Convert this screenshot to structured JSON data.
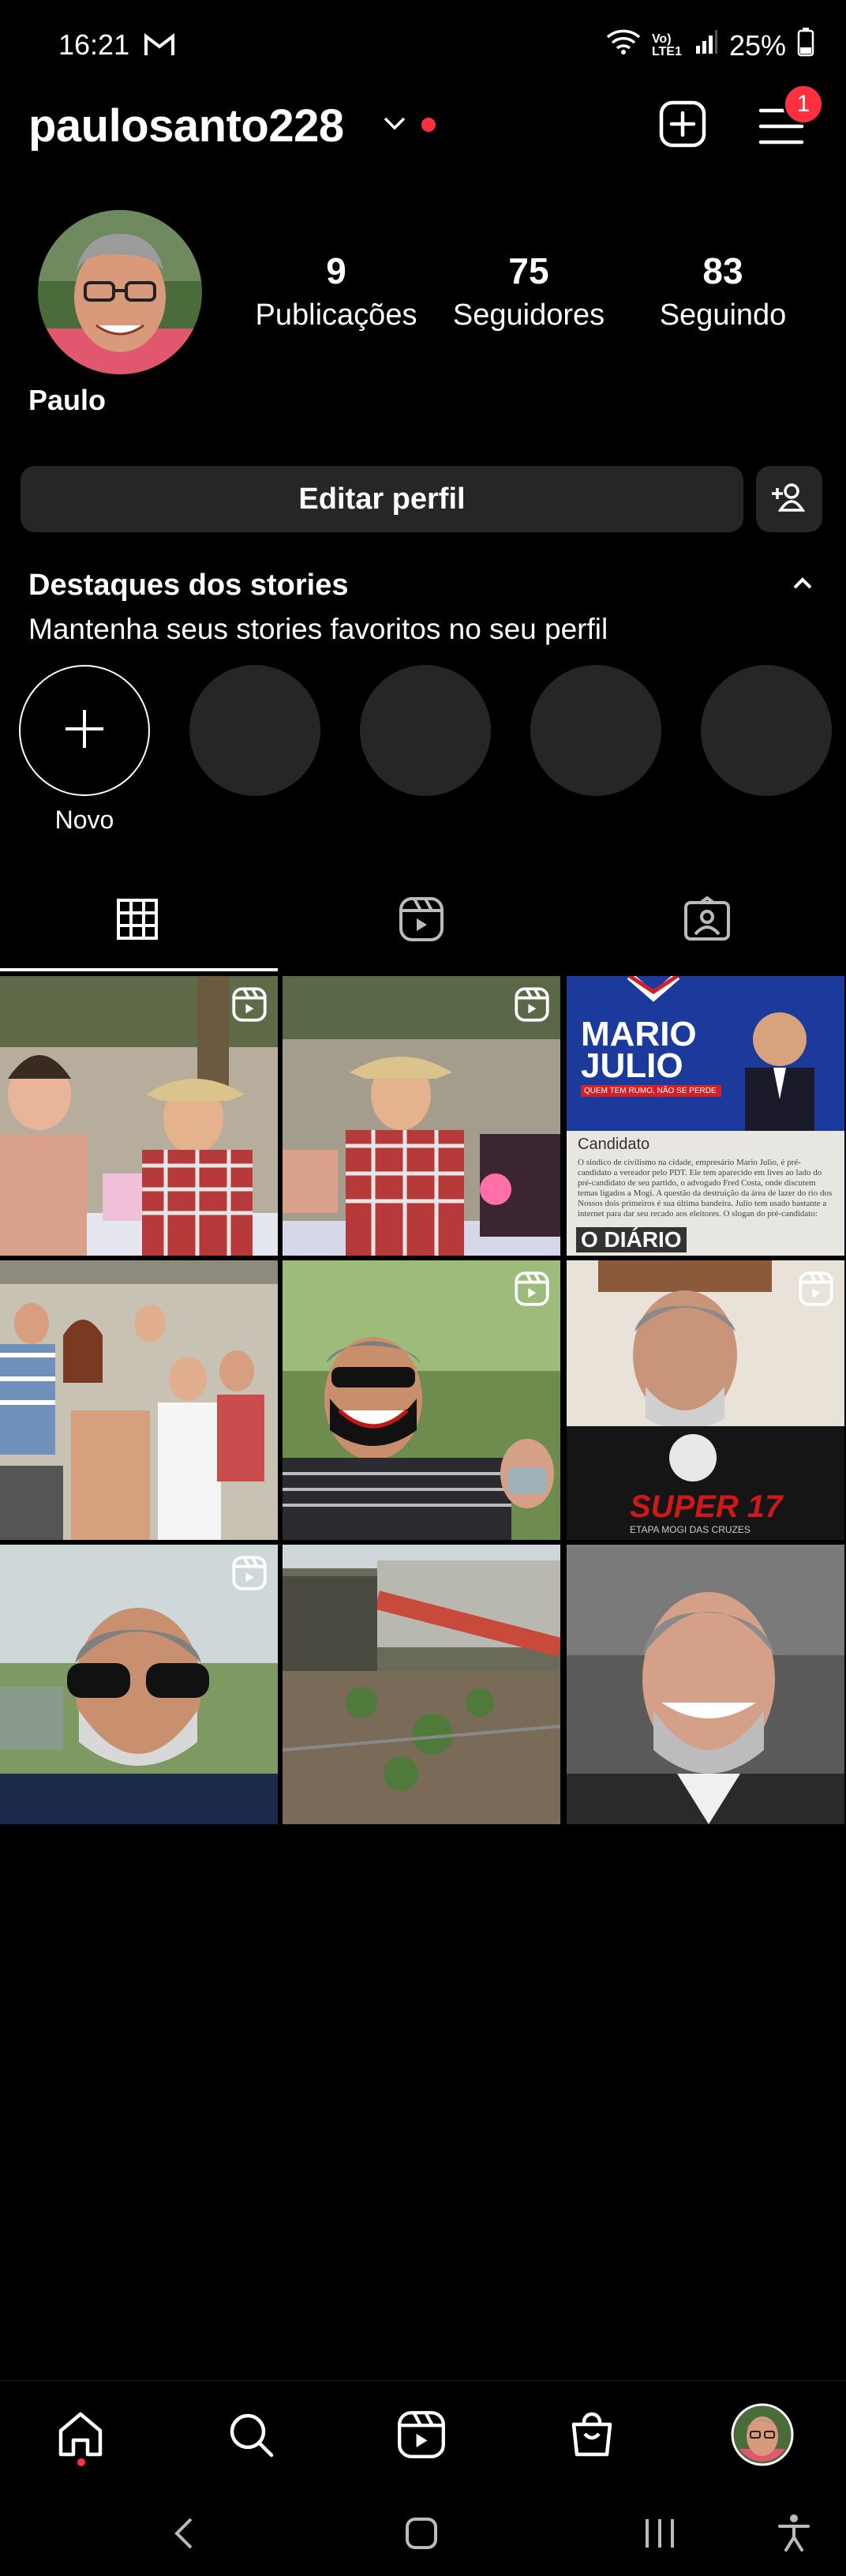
{
  "status_bar": {
    "time": "16:21",
    "battery": "25%",
    "network": "Vo) LTE1"
  },
  "header": {
    "username": "paulosanto228",
    "notification_count": "1"
  },
  "profile": {
    "name": "Paulo",
    "stats": [
      {
        "value": "9",
        "label": "Publicações"
      },
      {
        "value": "75",
        "label": "Seguidores"
      },
      {
        "value": "83",
        "label": "Seguindo"
      }
    ],
    "edit_label": "Editar perfil"
  },
  "highlights": {
    "title": "Destaques dos stories",
    "subtitle": "Mantenha seus stories favoritos no seu perfil",
    "new_label": "Novo"
  },
  "posts": [
    {
      "kind": "reel",
      "scene": "party-straw-hat"
    },
    {
      "kind": "reel",
      "scene": "party-straw-hat-2"
    },
    {
      "kind": "image",
      "scene": "newspaper",
      "headline": "MARIO JULIO",
      "tagline": "QUEM TEM RUMO, NÃO SE PERDE",
      "candidate_label": "Candidato",
      "paper_name": "O DIÁRIO",
      "body": "O síndico de civilismo na cidade, empresário Mario Julio, é pré-candidato a vereador pelo PDT. Ele tem aparecido em lives ao lado do pré-candidato de seu partido, o advogado Fred Costa, onde discutem temas ligados a Mogi. A questão da destruição da área de lazer do rio dos Nossos dois primeiros é sua última bandeira. Julio tem usado bastante a internet para dar seu recado aos eleitores. O slogan do pré-candidato: \"Quem tem rumo, não se perde\"."
    },
    {
      "kind": "image",
      "scene": "group-photo"
    },
    {
      "kind": "reel",
      "scene": "mask-selfie"
    },
    {
      "kind": "reel",
      "scene": "tshirt-selfie",
      "shirt_text": "SUPER 17",
      "shirt_sub": "ETAPA MOGI DAS CRUZES"
    },
    {
      "kind": "reel",
      "scene": "sunglasses-selfie"
    },
    {
      "kind": "image",
      "scene": "garden"
    },
    {
      "kind": "image",
      "scene": "portrait"
    }
  ],
  "colors": {
    "background": "#000000",
    "surface": "#262626",
    "accent_red": "#ff3040"
  }
}
